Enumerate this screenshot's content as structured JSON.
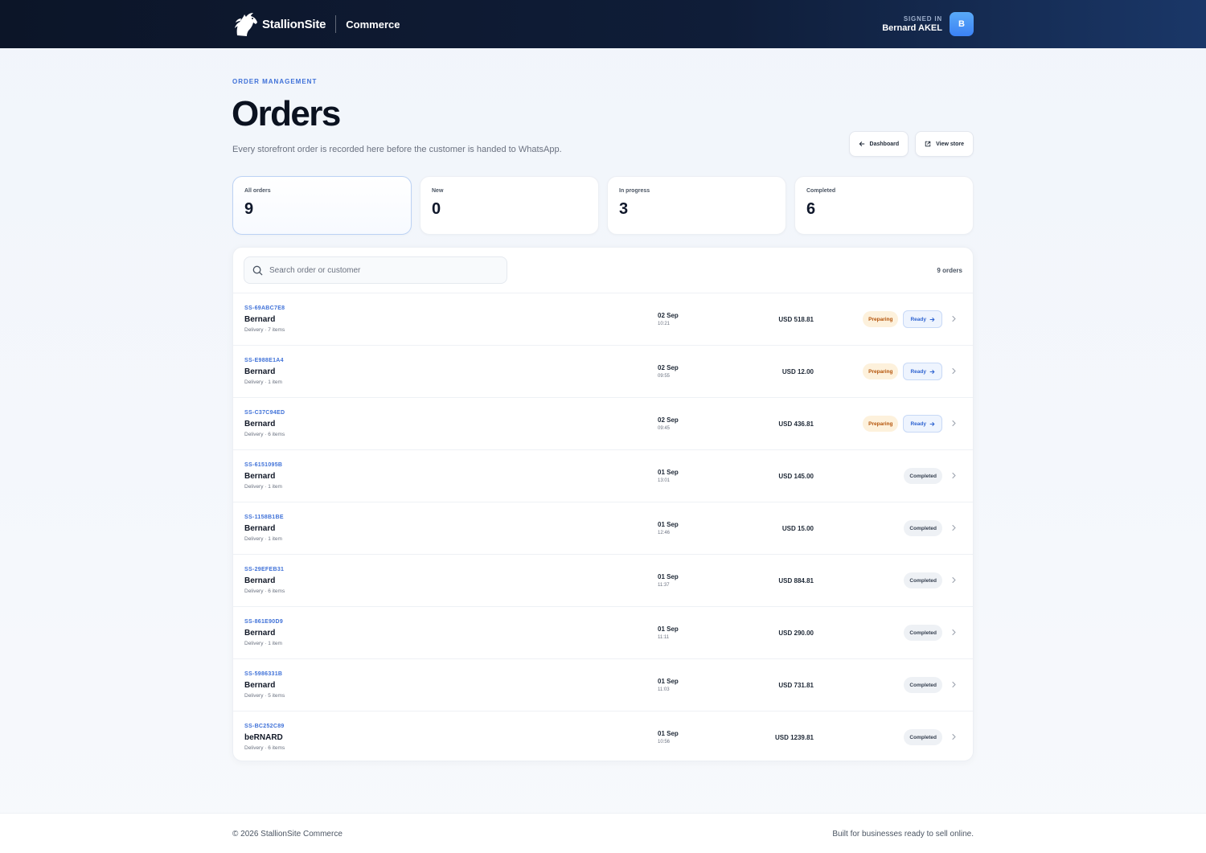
{
  "header": {
    "brand_name": "StallionSite",
    "product": "Commerce",
    "user_caption": "SIGNED IN",
    "user_name": "Bernard AKEL",
    "avatar_initial": "B"
  },
  "page": {
    "eyebrow": "ORDER MANAGEMENT",
    "title": "Orders",
    "subtitle": "Every storefront order is recorded here before the customer is handed to WhatsApp.",
    "actions": {
      "dashboard_label": "Dashboard",
      "view_store_label": "View store"
    }
  },
  "stats": [
    {
      "label": "All orders",
      "value": "9"
    },
    {
      "label": "New",
      "value": "0"
    },
    {
      "label": "In progress",
      "value": "3"
    },
    {
      "label": "Completed",
      "value": "6"
    }
  ],
  "orders_panel": {
    "search_placeholder": "Search order or customer",
    "count_label": "9 orders",
    "ready_label": "Ready",
    "rows": [
      {
        "id": "SS-69ABC7E8",
        "customer": "Bernard",
        "meta": "Delivery · 7 items",
        "date": "02 Sep",
        "time": "10:21",
        "amount": "USD 518.81",
        "status": "Preparing"
      },
      {
        "id": "SS-E988E1A4",
        "customer": "Bernard",
        "meta": "Delivery · 1 item",
        "date": "02 Sep",
        "time": "09:55",
        "amount": "USD 12.00",
        "status": "Preparing"
      },
      {
        "id": "SS-C37C94ED",
        "customer": "Bernard",
        "meta": "Delivery · 6 items",
        "date": "02 Sep",
        "time": "09:45",
        "amount": "USD 436.81",
        "status": "Preparing"
      },
      {
        "id": "SS-6151095B",
        "customer": "Bernard",
        "meta": "Delivery · 1 item",
        "date": "01 Sep",
        "time": "13:01",
        "amount": "USD 145.00",
        "status": "Completed"
      },
      {
        "id": "SS-1158B1BE",
        "customer": "Bernard",
        "meta": "Delivery · 1 item",
        "date": "01 Sep",
        "time": "12:46",
        "amount": "USD 15.00",
        "status": "Completed"
      },
      {
        "id": "SS-29EFEB31",
        "customer": "Bernard",
        "meta": "Delivery · 6 items",
        "date": "01 Sep",
        "time": "11:37",
        "amount": "USD 884.81",
        "status": "Completed"
      },
      {
        "id": "SS-861E90D9",
        "customer": "Bernard",
        "meta": "Delivery · 1 item",
        "date": "01 Sep",
        "time": "11:11",
        "amount": "USD 290.00",
        "status": "Completed"
      },
      {
        "id": "SS-5986331B",
        "customer": "Bernard",
        "meta": "Delivery · 5 items",
        "date": "01 Sep",
        "time": "11:03",
        "amount": "USD 731.81",
        "status": "Completed"
      },
      {
        "id": "SS-BC252C89",
        "customer": "beRNARD",
        "meta": "Delivery · 6 items",
        "date": "01 Sep",
        "time": "10:56",
        "amount": "USD 1239.81",
        "status": "Completed"
      }
    ]
  },
  "footer": {
    "copyright": "© 2026 StallionSite Commerce",
    "tagline": "Built for businesses ready to sell online."
  },
  "colors": {
    "accent": "#3f71d8",
    "header_bg": "#0c1528",
    "preparing_bg": "#fdf1dc",
    "preparing_text": "#b45309",
    "completed_bg": "#eef1f5"
  }
}
